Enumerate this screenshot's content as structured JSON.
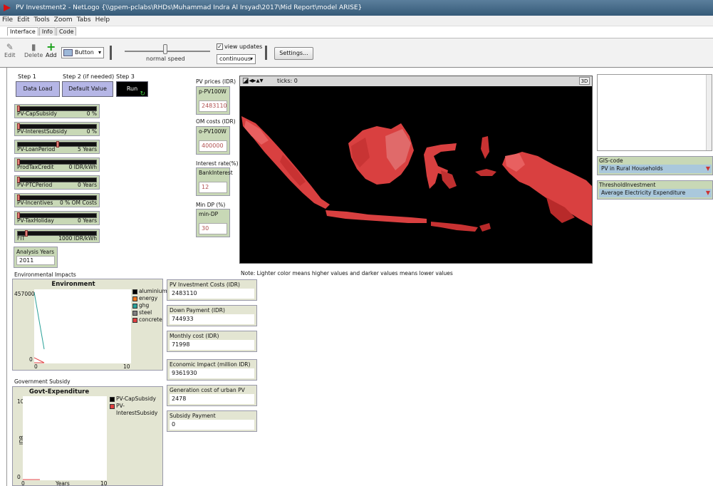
{
  "window": {
    "title": "PV Investment2 - NetLogo {\\\\gpem-pclabs\\RHDs\\Muhammad Indra Al Irsyad\\2017\\Mid Report\\model ARISE}"
  },
  "menu": [
    "File",
    "Edit",
    "Tools",
    "Zoom",
    "Tabs",
    "Help"
  ],
  "tabs": [
    "Interface",
    "Info",
    "Code"
  ],
  "toolbar": {
    "edit": "Edit",
    "delete": "Delete",
    "add": "Add",
    "widget_type": "Button",
    "speed_label": "normal speed",
    "view_updates_label": "view updates",
    "update_mode": "continuous",
    "settings": "Settings..."
  },
  "steps": {
    "step1_label": "Step 1",
    "step2_label": "Step 2 (if needed)",
    "step3_label": "Step 3",
    "data_load": "Data Load",
    "default_value": "Default Value",
    "run": "Run"
  },
  "sliders": [
    {
      "name": "PV-CapSubsidy",
      "value": "0 %",
      "level": 0.0
    },
    {
      "name": "PV-InterestSubsidy",
      "value": "0 %",
      "level": 0.0
    },
    {
      "name": "PV-LoanPeriod",
      "value": "5 Years",
      "level": 0.5
    },
    {
      "name": "ProdTaxCredit",
      "value": "0 IDR/kWh",
      "level": 0.0
    },
    {
      "name": "PV-PTCPeriod",
      "value": "0 Years",
      "level": 0.0
    },
    {
      "name": "PV-Incentives",
      "value": "0 % OM Costs",
      "level": 0.0
    },
    {
      "name": "PV-TaxHoliday",
      "value": "0 Years",
      "level": 0.0
    },
    {
      "name": "FIT",
      "value": "1000 IDR/kWh",
      "level": 0.1
    }
  ],
  "analysis_years": {
    "label": "Analysis Years",
    "value": "2011"
  },
  "inputs": {
    "pv_prices_title": "PV prices (IDR)",
    "pv_prices_label": "p-PV100W",
    "pv_prices_value": "2483110",
    "om_costs_title": "OM costs (IDR)",
    "om_costs_label": "o-PV100W",
    "om_costs_value": "400000",
    "interest_title": "Interest rate(%)",
    "interest_label": "BankInterest",
    "interest_value": "12",
    "min_dp_title": "Min DP (%)",
    "min_dp_label": "min-DP",
    "min_dp_value": "30"
  },
  "view": {
    "ticks_label": "ticks: 0",
    "three_d": "3D"
  },
  "map_note": "Note: Lighter color means higher values and darker values means lower values",
  "monitors": [
    {
      "label": "PV Investment Costs (IDR)",
      "value": "2483110"
    },
    {
      "label": "Down Payment (IDR)",
      "value": "744933"
    },
    {
      "label": "Monthly cost (IDR)",
      "value": "71998"
    },
    {
      "label": "Economic Impact (million IDR)",
      "value": "9361930"
    },
    {
      "label": "Generation cost of urban PV (IDR)",
      "value": "2478"
    },
    {
      "label": "Subsidy Payment (IDR/month/HH)",
      "value": "0"
    }
  ],
  "choosers": [
    {
      "label": "GIS-code",
      "value": "PV in Rural Households"
    },
    {
      "label": "ThresholdInvestment",
      "value": "Average Electricity Expenditure"
    }
  ],
  "env_section": "Environmental Impacts",
  "gov_section": "Government Subsidy",
  "env_plot": {
    "title": "Environment",
    "y_max": "457000",
    "y_min": "0",
    "x_min": "0",
    "x_max": "10",
    "legend": [
      {
        "name": "aluminium",
        "color": "#000000"
      },
      {
        "name": "energy",
        "color": "#f07820"
      },
      {
        "name": "ghg",
        "color": "#2aa198"
      },
      {
        "name": "steel",
        "color": "#808080"
      },
      {
        "name": "concrete",
        "color": "#e04040"
      }
    ]
  },
  "gov_plot": {
    "title": "Govt-Expenditure",
    "y_max": "10",
    "y_min": "0",
    "x_min": "0",
    "x_max": "10",
    "x_label": "Years",
    "y_label": "IDR",
    "legend": [
      {
        "name": "PV-CapSubsidy",
        "color": "#000000"
      },
      {
        "name": "PV-InterestSubsidy",
        "color": "#e04040"
      }
    ]
  }
}
